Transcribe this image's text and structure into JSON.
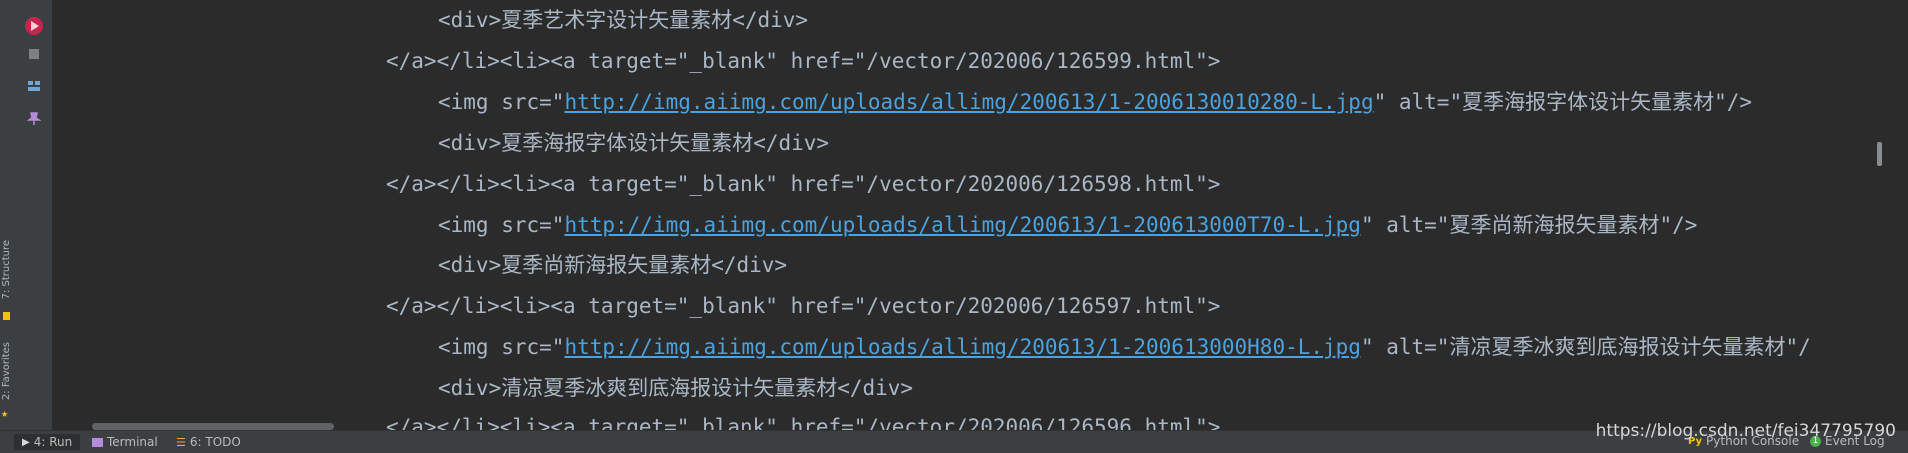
{
  "side_panels": {
    "structure_label": "7: Structure",
    "favorites_label": "2: Favorites"
  },
  "toolbar": {
    "buttons": [
      "run-icon",
      "stop-icon",
      "up-arrow-icon",
      "down-arrow-icon",
      "soft-wrap-icon",
      "layout-icon",
      "pin-icon",
      "scroll-end-icon",
      "print-icon",
      "delete-icon"
    ]
  },
  "editor": {
    "lines": [
      {
        "indent": 2,
        "text": "<div>夏季艺术字设计矢量素材</div>"
      },
      {
        "indent": 1,
        "text": "</a></li><li><a target=\"_blank\" href=\"/vector/202006/126599.html\">"
      },
      {
        "indent": 2,
        "pre": "<img src=\"",
        "link": "http://img.aiimg.com/uploads/allimg/200613/1-2006130010280-L.jpg",
        "post": "\" alt=\"夏季海报字体设计矢量素材\"/>"
      },
      {
        "indent": 2,
        "text": "<div>夏季海报字体设计矢量素材</div>"
      },
      {
        "indent": 1,
        "text": "</a></li><li><a target=\"_blank\" href=\"/vector/202006/126598.html\">"
      },
      {
        "indent": 2,
        "pre": "<img src=\"",
        "link": "http://img.aiimg.com/uploads/allimg/200613/1-200613000T70-L.jpg",
        "post": "\" alt=\"夏季尚新海报矢量素材\"/>"
      },
      {
        "indent": 2,
        "text": "<div>夏季尚新海报矢量素材</div>"
      },
      {
        "indent": 1,
        "text": "</a></li><li><a target=\"_blank\" href=\"/vector/202006/126597.html\">"
      },
      {
        "indent": 2,
        "pre": "<img src=\"",
        "link": "http://img.aiimg.com/uploads/allimg/200613/1-200613000H80-L.jpg",
        "post": "\" alt=\"清凉夏季冰爽到底海报设计矢量素材\"/"
      },
      {
        "indent": 2,
        "text": "<div>清凉夏季冰爽到底海报设计矢量素材</div>"
      },
      {
        "indent": 1,
        "text": "</a></li><li><a target=\"_blank\" href=\"/vector/202006/126596.html\">"
      }
    ]
  },
  "status_bar": {
    "tabs": [
      {
        "label": "4: Run",
        "icon": "run-icon",
        "active": true
      },
      {
        "label": "Terminal",
        "icon": "terminal-icon",
        "active": false
      },
      {
        "label": "6: TODO",
        "icon": "todo-icon",
        "active": false
      }
    ],
    "right": [
      {
        "label": "Python Console",
        "icon": "python-icon"
      },
      {
        "label": "Event Log",
        "icon": "event-log-icon"
      }
    ]
  },
  "watermark": "https://blog.csdn.net/fei347795790",
  "colors": {
    "background": "#2b2b2b",
    "panel": "#3c3f41",
    "text": "#a9b7c6",
    "link": "#4aa3df",
    "accent": "#e0245e"
  }
}
